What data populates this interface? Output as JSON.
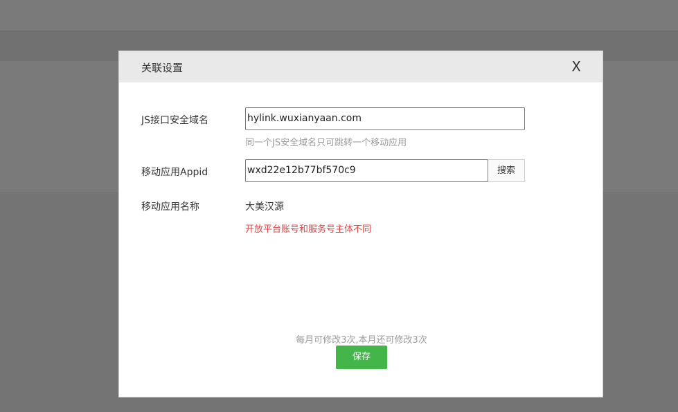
{
  "dialog": {
    "title": "关联设置",
    "close_label": "X",
    "js_domain": {
      "label": "JS接口安全域名",
      "value": "hylink.wuxianyaan.com",
      "hint": "同一个JS安全域名只可跳转一个移动应用"
    },
    "appid": {
      "label": "移动应用Appid",
      "value": "wxd22e12b77bf570c9",
      "search_label": "搜索"
    },
    "app_name": {
      "label": "移动应用名称",
      "value": "大美汉源",
      "error": "开放平台账号和服务号主体不同"
    },
    "quota_text": "每月可修改3次,本月还可修改3次",
    "save_label": "保存"
  },
  "colors": {
    "save_button": "#44b549",
    "error_text": "#e64340",
    "overlay": "rgba(0,0,0,0.5)"
  }
}
